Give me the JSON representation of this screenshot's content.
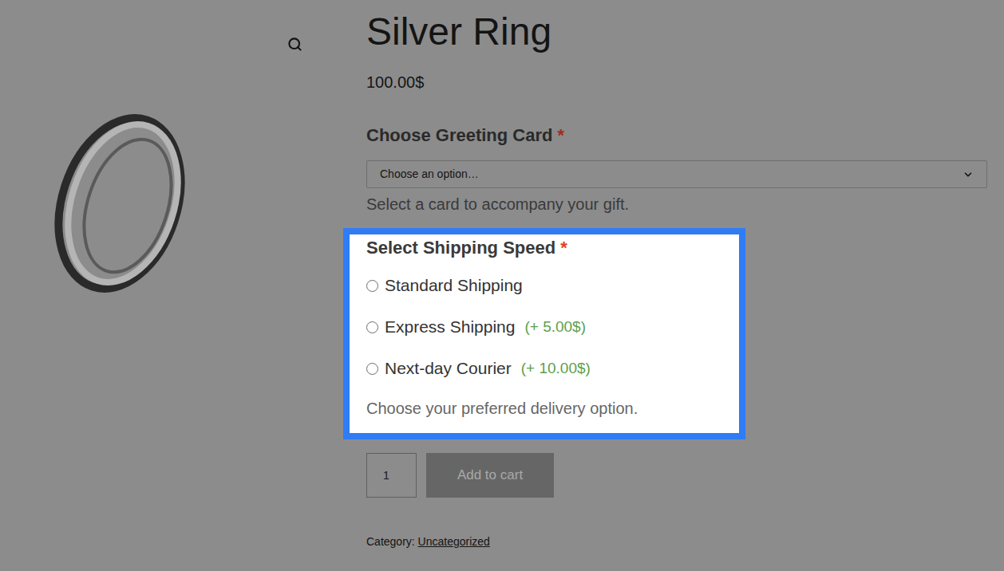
{
  "product": {
    "title": "Silver Ring",
    "price": "100.00$"
  },
  "greeting_card": {
    "label": "Choose Greeting Card",
    "required_mark": "*",
    "placeholder": "Choose an option…",
    "description": "Select a card to accompany your gift.",
    "highlighted": false
  },
  "shipping": {
    "label": "Select Shipping Speed",
    "required_mark": "*",
    "highlighted": true,
    "options": [
      {
        "label": "Standard Shipping",
        "selected": false
      },
      {
        "label": "Express Shipping",
        "price": "(+ 5.00$)",
        "selected": false
      },
      {
        "label": "Next-day Courier",
        "price": "(+ 10.00$)",
        "selected": false
      }
    ],
    "description": "Choose your preferred delivery option."
  },
  "cart": {
    "quantity": "1",
    "button": "Add to cart"
  },
  "category": {
    "label": "Category:",
    "value": "Uncategorized"
  }
}
